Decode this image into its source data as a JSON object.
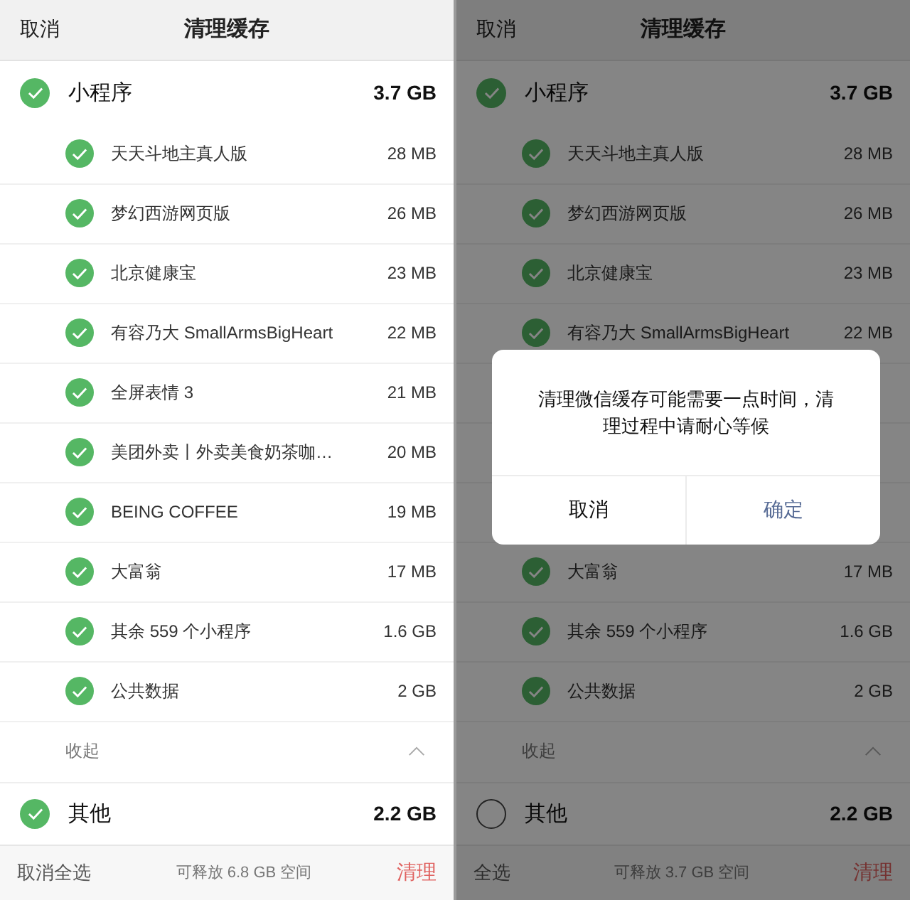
{
  "screens": [
    {
      "header": {
        "cancel": "取消",
        "title": "清理缓存"
      },
      "group": {
        "name": "小程序",
        "size": "3.7 GB",
        "checked": true,
        "collapse": "收起",
        "items": [
          {
            "kind": "app",
            "name": "天天斗地主真人版",
            "size": "28 MB",
            "checked": true
          },
          {
            "kind": "app",
            "name": "梦幻西游网页版",
            "size": "26 MB",
            "checked": true
          },
          {
            "kind": "app",
            "name": "北京健康宝",
            "size": "23 MB",
            "checked": true
          },
          {
            "kind": "app",
            "name": "有容乃大 SmallArmsBigHeart",
            "size": "22 MB",
            "checked": true
          },
          {
            "kind": "app",
            "name": "全屏表情 3",
            "size": "21 MB",
            "checked": true
          },
          {
            "kind": "app",
            "name": "美团外卖丨外卖美食奶茶咖…",
            "size": "20 MB",
            "checked": true
          },
          {
            "kind": "app",
            "name": "BEING COFFEE",
            "size": "19 MB",
            "checked": true
          },
          {
            "kind": "app",
            "name": "大富翁",
            "size": "17 MB",
            "checked": true
          },
          {
            "kind": "app",
            "name": "其余 559 个小程序",
            "size": "1.6 GB",
            "checked": true
          },
          {
            "kind": "app",
            "name": "公共数据",
            "size": "2 GB",
            "checked": true
          }
        ]
      },
      "other": {
        "name": "其他",
        "size": "2.2 GB",
        "checked": true
      },
      "footer": {
        "select": "取消全选",
        "info": "可释放 6.8 GB 空间",
        "clear": "清理"
      }
    },
    {
      "header": {
        "cancel": "取消",
        "title": "清理缓存"
      },
      "group": {
        "name": "小程序",
        "size": "3.7 GB",
        "checked": true,
        "collapse": "收起",
        "items": [
          {
            "kind": "app",
            "name": "天天斗地主真人版",
            "size": "28 MB",
            "checked": true
          },
          {
            "kind": "app",
            "name": "梦幻西游网页版",
            "size": "26 MB",
            "checked": true
          },
          {
            "kind": "app",
            "name": "北京健康宝",
            "size": "23 MB",
            "checked": true
          },
          {
            "kind": "app",
            "name": "有容乃大 SmallArmsBigHeart",
            "size": "22 MB",
            "checked": true
          },
          {
            "kind": "covered"
          },
          {
            "kind": "covered"
          },
          {
            "kind": "covered"
          },
          {
            "kind": "app",
            "name": "大富翁",
            "size": "17 MB",
            "checked": true
          },
          {
            "kind": "app",
            "name": "其余 559 个小程序",
            "size": "1.6 GB",
            "checked": true
          },
          {
            "kind": "app",
            "name": "公共数据",
            "size": "2 GB",
            "checked": true
          }
        ]
      },
      "other": {
        "name": "其他",
        "size": "2.2 GB",
        "checked": false
      },
      "footer": {
        "select": "全选",
        "info": "可释放 3.7 GB 空间",
        "clear": "清理"
      },
      "dialog": {
        "message": "清理微信缓存可能需要一点时间，清理过程中请耐心等候",
        "buttons": [
          "取消",
          "确定"
        ]
      }
    }
  ]
}
